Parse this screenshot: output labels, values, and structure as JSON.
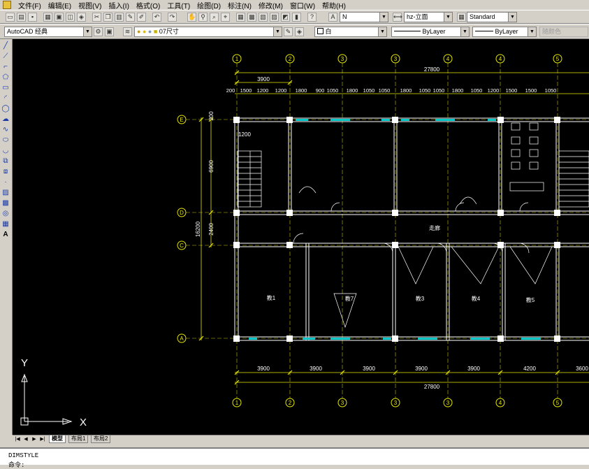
{
  "menu": {
    "items": [
      "文件(F)",
      "编辑(E)",
      "视图(V)",
      "插入(I)",
      "格式(O)",
      "工具(T)",
      "绘图(D)",
      "标注(N)",
      "修改(M)",
      "窗口(W)",
      "帮助(H)"
    ]
  },
  "toolbar_styles": {
    "text_style": "N",
    "dim_style": "hz-立面",
    "table_style": "Standard"
  },
  "toolbar_props": {
    "workspace": "AutoCAD 经典",
    "layer": "07尺寸",
    "color": "白",
    "linetype": "ByLayer",
    "lineweight": "ByLayer",
    "plotstyle": "随颜色"
  },
  "drawing": {
    "axes_top": [
      "1",
      "2",
      "3",
      "3",
      "4",
      "4",
      "5"
    ],
    "axes_bottom": [
      "1",
      "2",
      "3",
      "3",
      "3",
      "4",
      "5"
    ],
    "axes_left": [
      "E",
      "D",
      "C",
      "A"
    ],
    "dim_total": "27800",
    "dim_first_bay": "3900",
    "dim_bottom_bays": [
      "3900",
      "3900",
      "3900",
      "3900",
      "3900",
      "4200",
      "3600"
    ],
    "dim_top_detail": [
      "200",
      "1500",
      "1200",
      "1200",
      "1800",
      "900",
      "1050",
      "1800",
      "1050",
      "1050",
      "1800",
      "1050",
      "1050",
      "1800",
      "1050",
      "1200",
      "1500",
      "1500",
      "1050"
    ],
    "dim_vertical": [
      "6900",
      "2400",
      "16200",
      "200"
    ],
    "stair_dim": "1200",
    "corridor_label": "走廊",
    "room_labels": [
      "教1",
      "教7",
      "教3",
      "教4",
      "教5"
    ],
    "ucs_x": "X",
    "ucs_y": "Y"
  },
  "tabs": {
    "items": [
      "模型",
      "布局1",
      "布局2"
    ],
    "active": "模型"
  },
  "command": {
    "history": "DIMSTYLE",
    "prompt": "命令:"
  }
}
